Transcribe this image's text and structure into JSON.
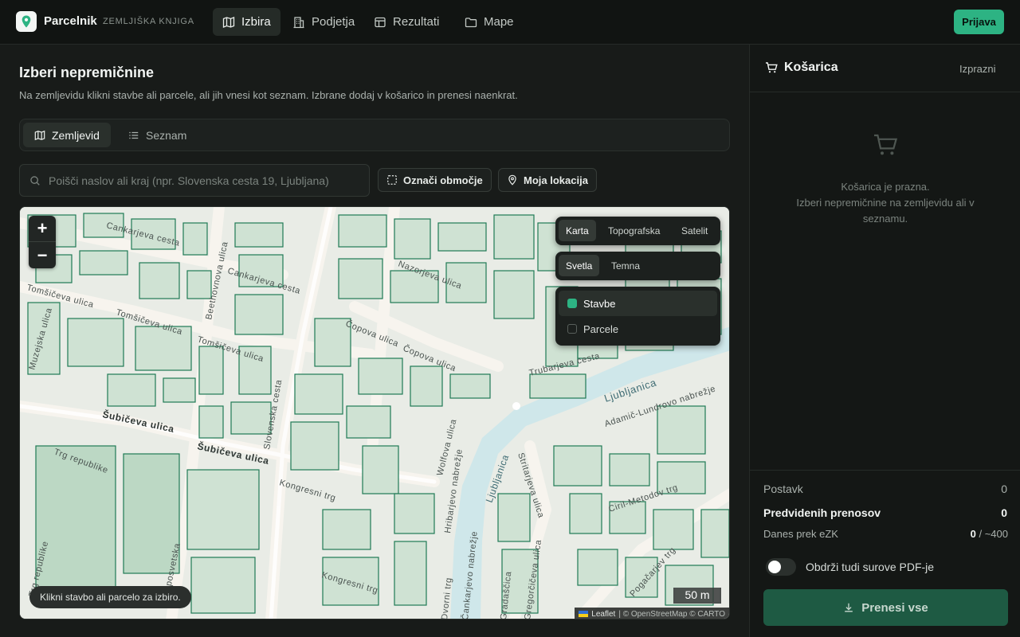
{
  "app": {
    "name": "Parcelnik",
    "subtitle": "ZEMLJIŠKA KNJIGA"
  },
  "nav": {
    "items": [
      "Izbira",
      "Podjetja",
      "Rezultati",
      "Mape"
    ],
    "login": "Prijava"
  },
  "page": {
    "title": "Izberi nepremičnine",
    "description": "Na zemljevidu klikni stavbe ali parcele, ali jih vnesi kot seznam. Izbrane dodaj v košarico in prenesi naenkrat.",
    "tabs": [
      "Zemljevid",
      "Seznam"
    ],
    "search_placeholder": "Poišči naslov ali kraj (npr. Slovenska cesta 19, Ljubljana)",
    "mark_area": "Označi območje",
    "my_location": "Moja lokacija"
  },
  "map": {
    "zoom_in": "+",
    "zoom_out": "−",
    "basemaps": [
      "Karta",
      "Topografska",
      "Satelit"
    ],
    "themes": [
      "Svetla",
      "Temna"
    ],
    "layers": [
      "Stavbe",
      "Parcele"
    ],
    "hint": "Klikni stavbo ali parcelo za izbiro.",
    "scale": "50 m",
    "attribution": [
      "Leaflet",
      "| © OpenStreetMap © CARTO"
    ],
    "street_labels": [
      "Cankarjeva cesta",
      "Cankarjeva cesta",
      "Tomšičeva ulica",
      "Tomšičeva ulica",
      "Tomšičeva ulica",
      "Muzejska ulica",
      "Beethovnova ulica",
      "Slovenska cesta",
      "Čopova ulica",
      "Čopova ulica",
      "Nazorjeva ulica",
      "Trubarjeva cesta",
      "Ljubljanica",
      "Adamič-Lundrovo nabrežje",
      "Šubičeva ulica",
      "Šubičeva ulica",
      "Trg republike",
      "Kongresni trg",
      "Kongresni trg",
      "Wolfova ulica",
      "Hribarjevo nabrežje",
      "Stritarjeva ulica",
      "Ciril-Metodov trg",
      "Ljubljanica",
      "Trg republike",
      "Gosposvetska",
      "Čankarjevo nabrežje",
      "Pogačarjev trg",
      "Gregorčičeva ulica",
      "Dvorni trg",
      "Gradaščica"
    ]
  },
  "cart": {
    "title": "Košarica",
    "clear": "Izprazni",
    "empty_line1": "Košarica je prazna.",
    "empty_line2": "Izberi nepremičnine na zemljevidu ali v seznamu.",
    "items_label": "Postavk",
    "items_value": "0",
    "transfers_label": "Predvidenih prenosov",
    "transfers_value": "0",
    "today_label": "Danes prek eZK",
    "today_value": "0",
    "today_limit": "/ ~400",
    "pdf_toggle": "Obdrži tudi surove PDF-je",
    "download": "Prenesi vse"
  },
  "colors": {
    "accent": "#2db383",
    "map_buildings": "#1f7a55",
    "river": "#cfe7ea"
  }
}
